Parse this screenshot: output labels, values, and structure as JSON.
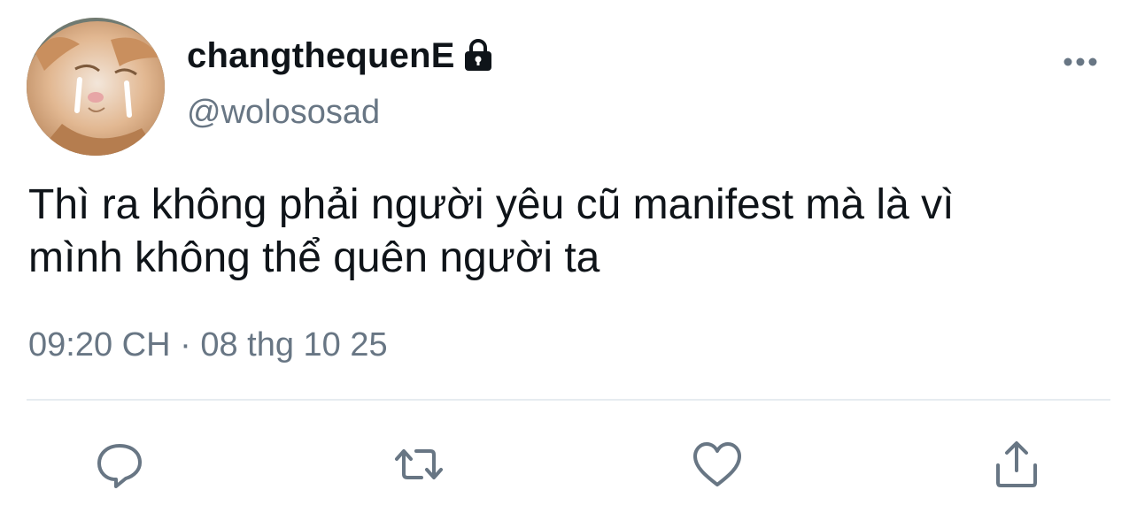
{
  "author": {
    "display_name": "changthequenE",
    "handle": "@wolososad",
    "protected": true,
    "avatar_icon": "cat-avatar"
  },
  "tweet": {
    "text": "Thì ra không phải người yêu cũ manifest mà là vì\nmình không thể quên người ta",
    "time": "09:20 CH",
    "separator": " · ",
    "date": "08 thg 10 25"
  },
  "actions": [
    {
      "icon": "reply-icon"
    },
    {
      "icon": "retweet-icon"
    },
    {
      "icon": "like-icon"
    },
    {
      "icon": "share-icon"
    }
  ],
  "colors": {
    "text": "#0f1419",
    "secondary": "#687684",
    "divider": "#e6ecf0"
  }
}
